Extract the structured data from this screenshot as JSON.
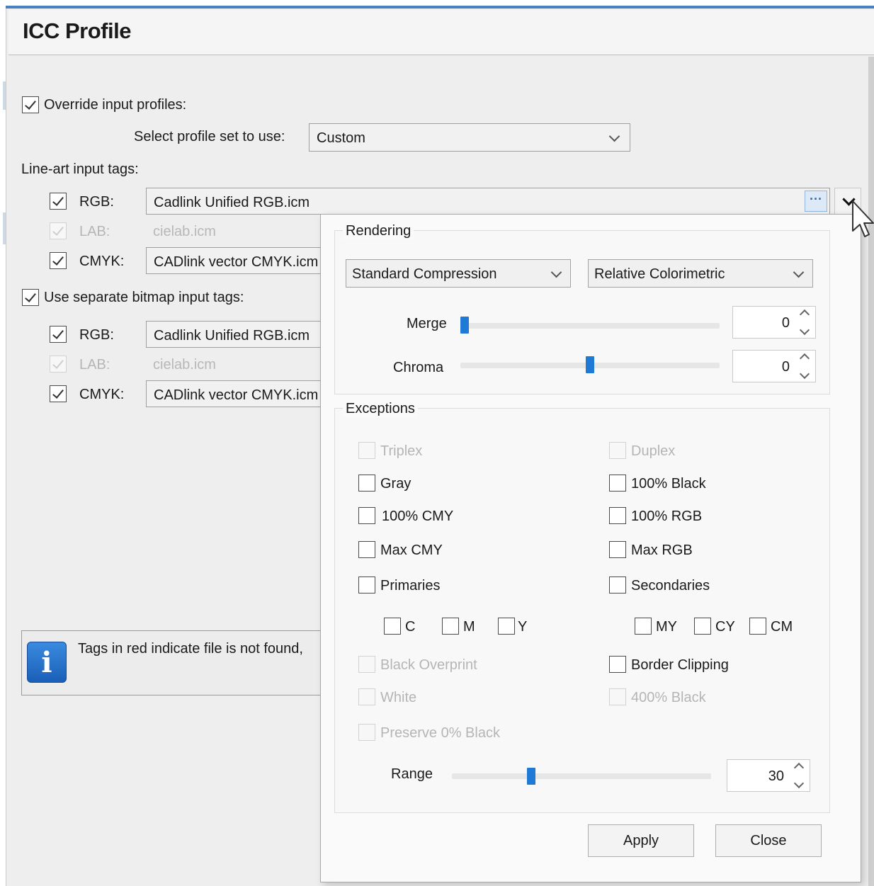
{
  "dialog": {
    "title": "ICC Profile"
  },
  "override": {
    "label": "Override input profiles:",
    "checked": true
  },
  "profile_set": {
    "label": "Select profile set to use:",
    "value": "Custom"
  },
  "line_art": {
    "title": "Line-art input tags:",
    "rgb": {
      "label": "RGB:",
      "value": "Cadlink Unified RGB.icm"
    },
    "lab": {
      "label": "LAB:",
      "value": "cielab.icm"
    },
    "cmyk": {
      "label": "CMYK:",
      "value": "CADlink vector CMYK.icm"
    },
    "ellipsis": "···"
  },
  "bitmap": {
    "label": "Use separate bitmap input tags:",
    "rgb": {
      "label": "RGB:",
      "value": "Cadlink Unified RGB.icm"
    },
    "lab": {
      "label": "LAB:",
      "value": "cielab.icm"
    },
    "cmyk": {
      "label": "CMYK:",
      "value": "CADlink vector CMYK.icm"
    }
  },
  "info": {
    "text": "Tags in red indicate file is not found,"
  },
  "rendering": {
    "title": "Rendering",
    "compression": "Standard Compression",
    "intent": "Relative Colorimetric",
    "merge": {
      "label": "Merge",
      "value": "0",
      "level": 0.0
    },
    "chroma": {
      "label": "Chroma",
      "value": "0",
      "level": 0.5
    }
  },
  "exceptions": {
    "title": "Exceptions",
    "triplex": "Triplex",
    "duplex": "Duplex",
    "gray": "Gray",
    "black100": "100% Black",
    "cmy100": "100% CMY",
    "rgb100": "100% RGB",
    "maxcmy": "Max CMY",
    "maxrgb": "Max RGB",
    "primaries": "Primaries",
    "secondaries": "Secondaries",
    "c": "C",
    "m": "M",
    "y": "Y",
    "my": "MY",
    "cy": "CY",
    "cm": "CM",
    "black_overprint": "Black Overprint",
    "border_clipping": "Border Clipping",
    "white": "White",
    "black400": "400% Black",
    "preserve_black": "Preserve 0% Black",
    "range": {
      "label": "Range",
      "value": "30",
      "level": 0.3
    }
  },
  "buttons": {
    "apply": "Apply",
    "close": "Close"
  }
}
